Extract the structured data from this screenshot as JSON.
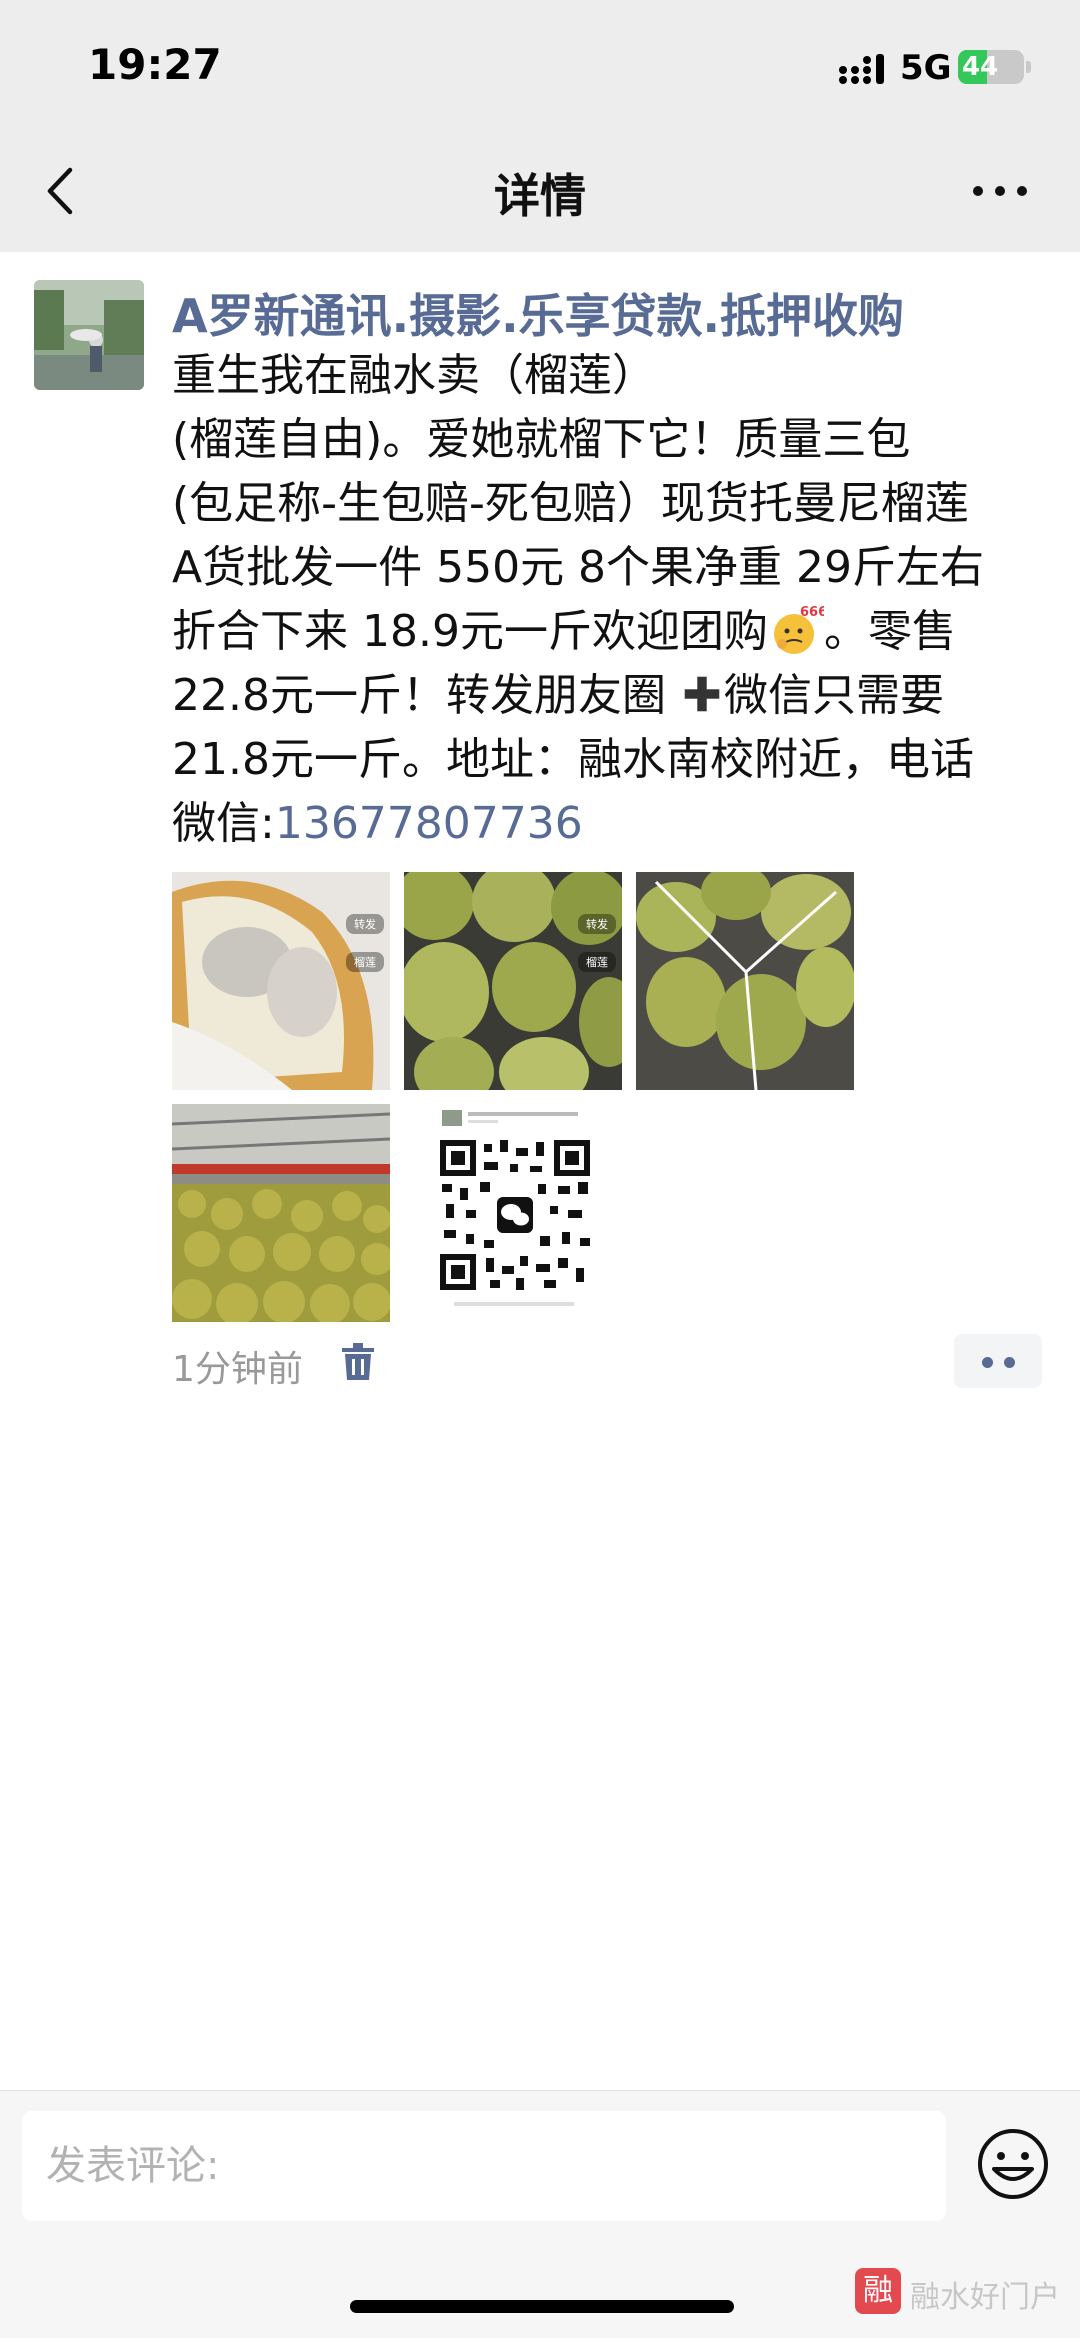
{
  "status_bar": {
    "time": "19:27",
    "network": "5G",
    "battery": "44",
    "battery_level_pct": 44
  },
  "nav": {
    "title": "详情"
  },
  "post": {
    "author": "A罗新通讯.摄影.乐享贷款.抵押收购",
    "content_lines": [
      "重生我在融水卖（榴莲）",
      "(榴莲自由)。爱她就榴下它！质量三包",
      "(包足称-生包赔-死包赔）现货托曼尼榴莲",
      "A货批发一件 550元 8个果净重 29斤左右",
      "折合下来 18.9元一斤欢迎团购",
      "。零售",
      "22.8元一斤！转发朋友圈",
      "微信只需要",
      "21.8元一斤。地址：融水南校附近，电话",
      "微信:"
    ],
    "phone": "13677807736",
    "emoji_badge": "666",
    "photos": [
      {
        "name": "durian-flesh-photo",
        "tags": [
          "转发",
          "榴莲"
        ]
      },
      {
        "name": "durian-pile-photo",
        "tags": [
          "转发",
          "榴莲"
        ]
      },
      {
        "name": "durian-bundle-photo",
        "tags": []
      },
      {
        "name": "durian-warehouse-photo",
        "tags": []
      },
      {
        "name": "qr-code-photo",
        "tags": []
      }
    ],
    "time_ago": "1分钟前"
  },
  "comment_bar": {
    "placeholder": "发表评论:"
  },
  "brand": {
    "logo_char": "融",
    "name": "融水好门户"
  },
  "colors": {
    "link": "#576b95",
    "nav_bg": "#ededed",
    "battery_green": "#34c759"
  }
}
